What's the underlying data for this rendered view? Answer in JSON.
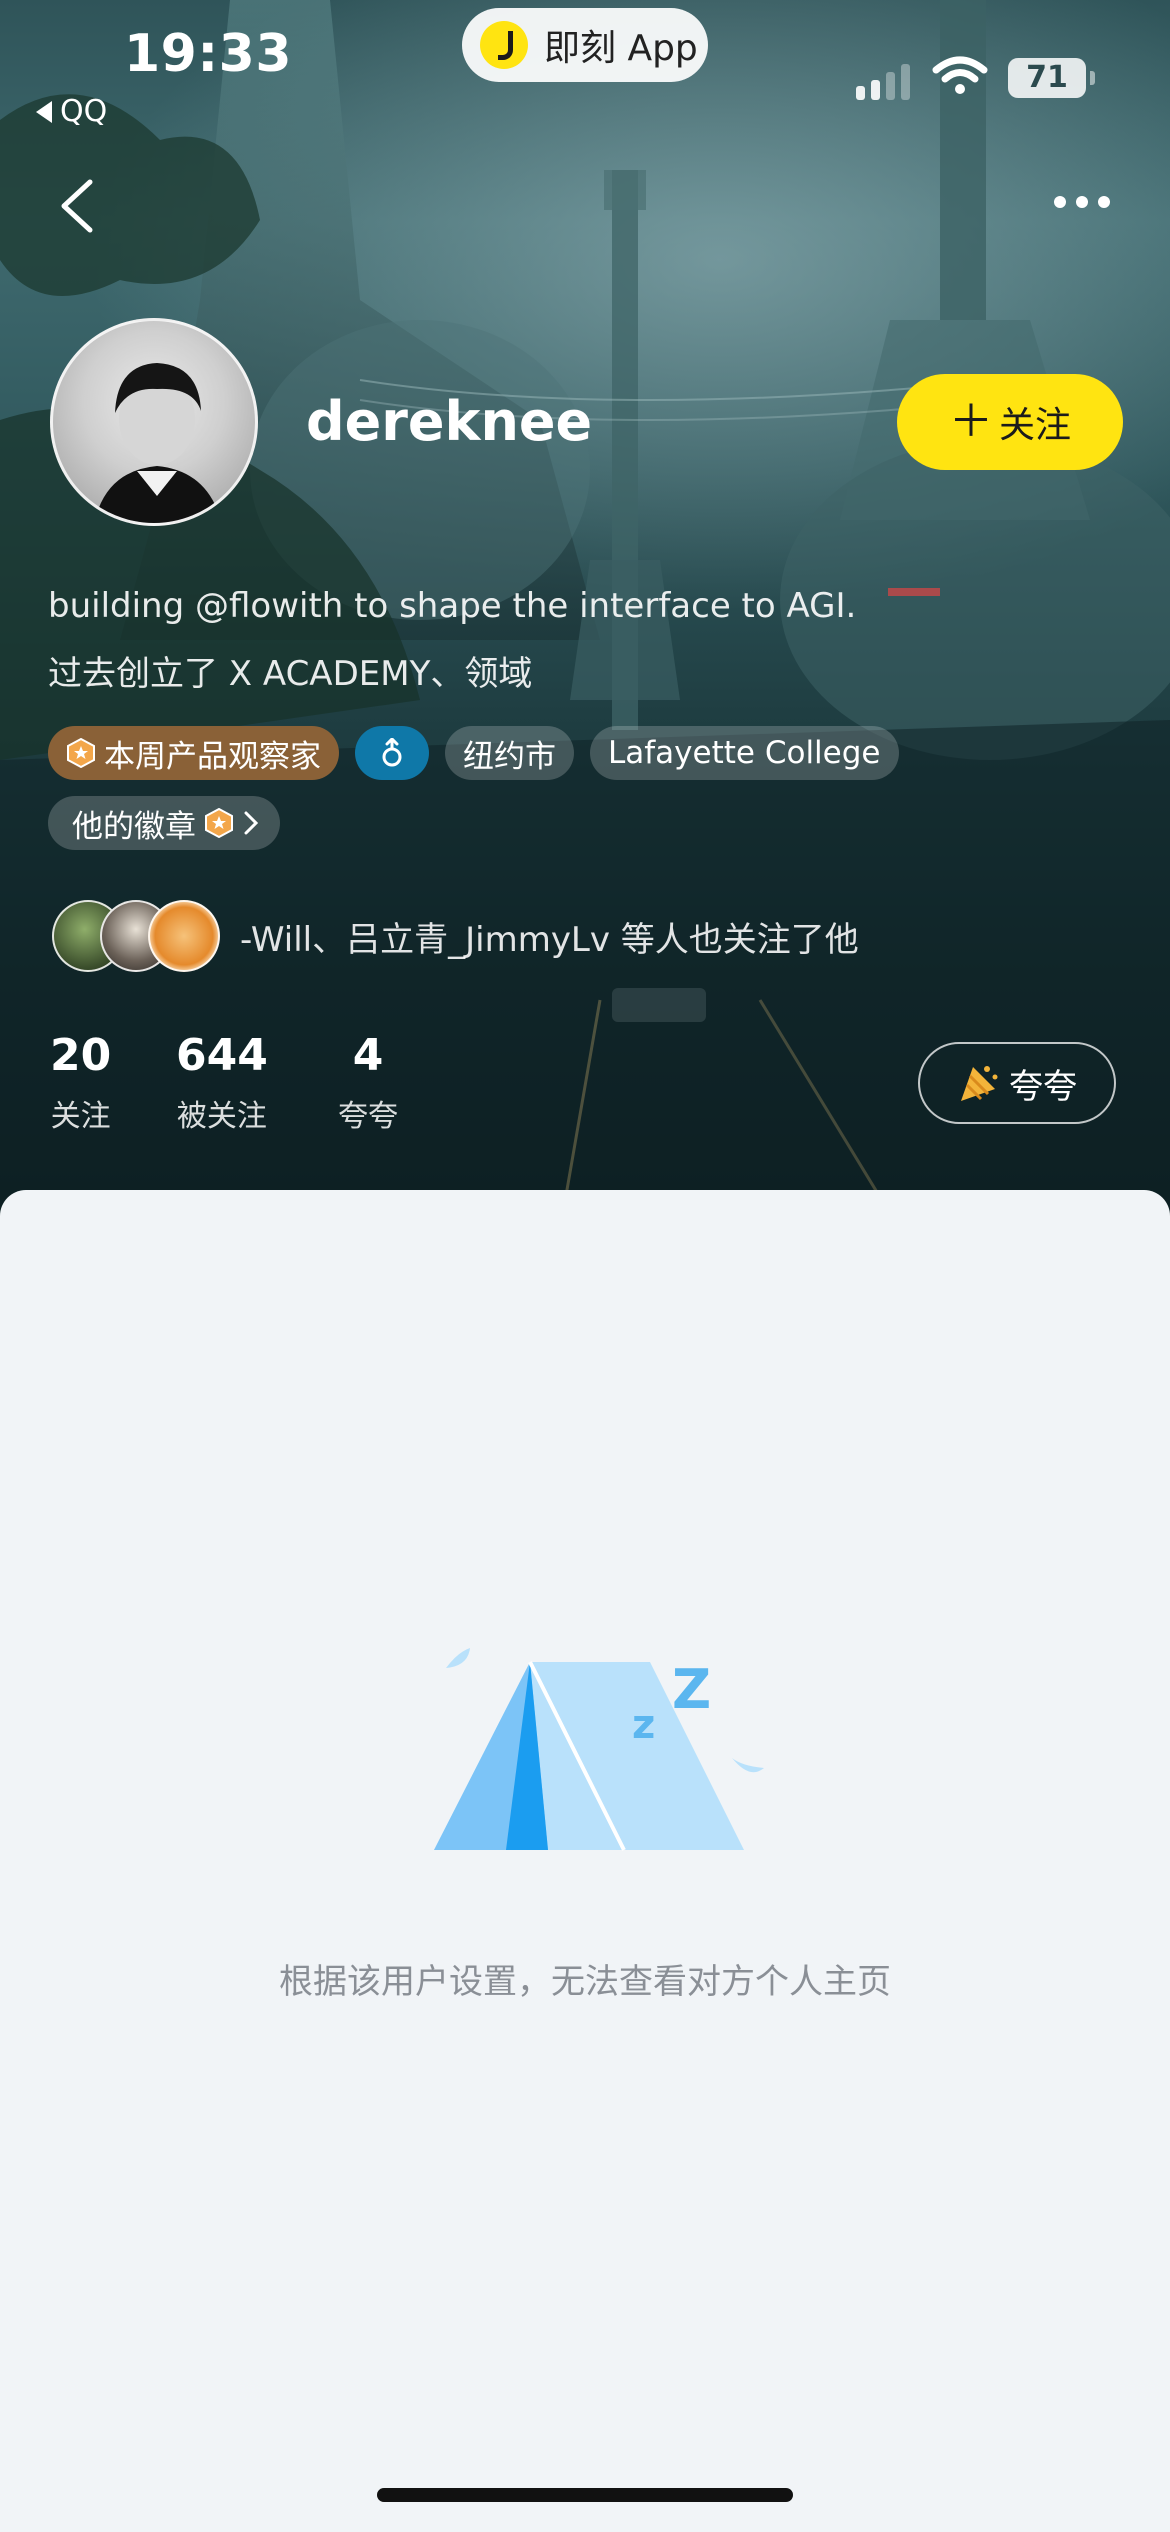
{
  "status_bar": {
    "time": "19:33",
    "back_app": "QQ",
    "center_pill": "即刻 App",
    "battery": "71"
  },
  "profile": {
    "username": "dereknee",
    "follow_label": "关注",
    "bio_line1": "building @flowith to shape the interface to AGI.",
    "bio_line2": "过去创立了 X ACADEMY、领域",
    "tags": {
      "observer": "本周产品观察家",
      "city": "纽约市",
      "school": "Lafayette College"
    },
    "badges_label": "他的徽章",
    "mutual_text": "-Will、吕立青_JimmyLv 等人也关注了他",
    "stats": [
      {
        "num": "20",
        "label": "关注"
      },
      {
        "num": "644",
        "label": "被关注"
      },
      {
        "num": "4",
        "label": "夸夸"
      }
    ],
    "praise_label": "夸夸"
  },
  "empty_state": {
    "message": "根据该用户设置，无法查看对方个人主页"
  },
  "colors": {
    "accent_yellow": "#ffe411",
    "tag_orange": "#8a6137",
    "tag_blue": "#0f78a8",
    "tent_blue": "#7cc4f7"
  }
}
